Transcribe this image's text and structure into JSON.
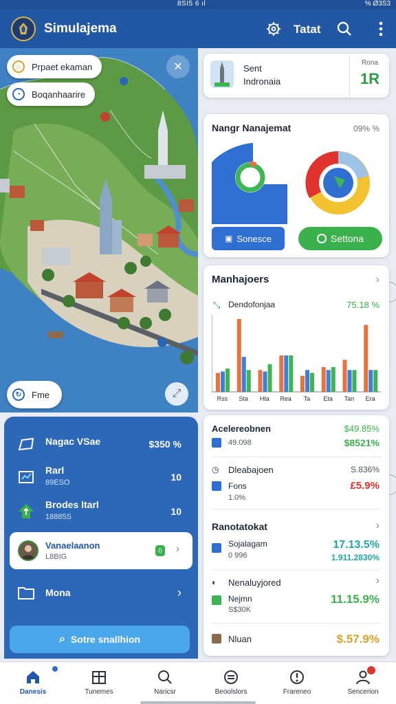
{
  "status_bar": {
    "center": "8SI5 6 ıl",
    "right": "%  Ø3S3"
  },
  "app_bar": {
    "title": "Simulajema",
    "action_label": "Tatat",
    "icons": [
      "logo-emblem",
      "gear-icon",
      "search-icon",
      "more-icon"
    ]
  },
  "map": {
    "chips": [
      {
        "label": "Prpaet ekaman",
        "icon": "pin-icon"
      },
      {
        "label": "Boqanhaarire",
        "icon": "clock-icon"
      }
    ],
    "bottom_chip": {
      "label": "Fme",
      "icon": "refresh-icon"
    }
  },
  "side_panel": {
    "rows": [
      {
        "title": "Nagac VSae",
        "subtitle": "",
        "value": "$350 %",
        "icon": "chat-bubble-icon"
      },
      {
        "title": "Rarl",
        "subtitle": "89ESO",
        "value": "10",
        "icon": "chart-board-icon"
      },
      {
        "title": "Brodes ltarl",
        "subtitle": "18885S",
        "value": "10",
        "icon": "house-up-icon"
      }
    ],
    "active_row": {
      "title": "Vanaelaanon",
      "subtitle": "L8BIG",
      "badge": "0"
    },
    "folder_row": {
      "title": "Mona"
    },
    "search_button": "Sotre snallhion"
  },
  "location_card": {
    "name": "Sent",
    "region": "Indronaia",
    "box_label": "Rona",
    "box_value": "1R"
  },
  "management_card": {
    "title": "Nangr Nanajemat",
    "percent": "09% %",
    "button_blue": "Sonesce",
    "button_green": "Settona",
    "accent_blue": "#2f6fd1",
    "accent_green": "#3bb14d"
  },
  "bar_card": {
    "title": "Manhajoers",
    "subtitle": "Dendofonjaa",
    "percent": "75.18 %",
    "ticks": [
      "Rss",
      "Sta",
      "Hta",
      "Rea",
      "Ta",
      "Eta",
      "Tan",
      "Era"
    ]
  },
  "chart_data": {
    "type": "bar",
    "categories": [
      "Rss",
      "Sta",
      "Hta",
      "Rea",
      "Ta",
      "Eta",
      "Tan",
      "Era"
    ],
    "series": [
      {
        "values": [
          26,
          100,
          30,
          50,
          22,
          34,
          44,
          92
        ]
      },
      {
        "values": [
          28,
          48,
          28,
          50,
          30,
          30,
          30,
          30
        ]
      },
      {
        "values": [
          32,
          30,
          38,
          50,
          26,
          34,
          30,
          30
        ]
      }
    ],
    "series_colors": [
      "#e8723a",
      "#3f7fd9",
      "#3cb552"
    ],
    "title": "",
    "xlabel": "",
    "ylabel": ""
  },
  "accounts_card": {
    "row1": {
      "title": "Acelereobnen",
      "value": "$49.85%",
      "sub": "49.098",
      "sub_value": "$8521%"
    },
    "row2": {
      "title": "Dleabajoen",
      "value": "S.836%",
      "sub": "Fons",
      "sub2": "1.0%",
      "sub_value": "£5.9%"
    },
    "section_title": "Ranotatokat",
    "row3": {
      "title": "Sojalagam",
      "sub": "0 996",
      "value": "17.13.5%",
      "value2": "1.911.2830%"
    },
    "row4": {
      "title": "Nenaluyjored",
      "sub": "Nejmn",
      "sub2": "S$30K",
      "value": "11.15.9%"
    },
    "row5": {
      "title": "Nluan",
      "value": "$.57.9%"
    }
  },
  "bottom_nav": [
    {
      "label": "Danesis",
      "icon": "home-icon",
      "active": true
    },
    {
      "label": "Tunemes",
      "icon": "grid-icon",
      "active": false
    },
    {
      "label": "Naricsr",
      "icon": "search-icon",
      "active": false
    },
    {
      "label": "Beoolslors",
      "icon": "calculator-icon",
      "active": false
    },
    {
      "label": "Frareneo",
      "icon": "alert-icon",
      "active": false
    },
    {
      "label": "Sencerion",
      "icon": "profile-icon",
      "active": false
    }
  ]
}
